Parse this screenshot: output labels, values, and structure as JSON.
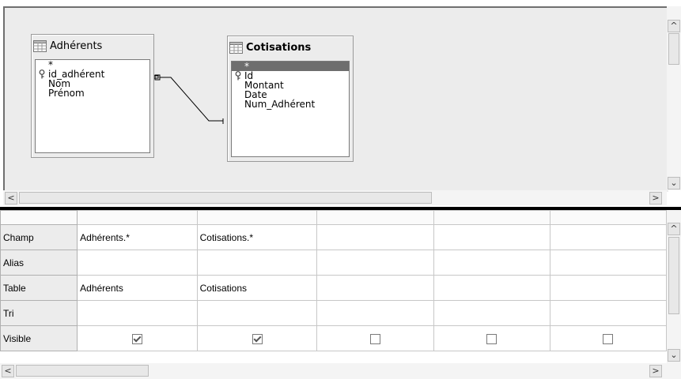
{
  "designer": {
    "tables": [
      {
        "name": "Adhérents",
        "fields": [
          "*",
          "id_adhérent",
          "Nom",
          "Prénom"
        ],
        "key_field_index": 1
      },
      {
        "name": "Cotisations",
        "fields": [
          "*",
          "Id",
          "Montant",
          "Date",
          "Num_Adhérent"
        ],
        "key_field_index": 1,
        "selected_field_index": 0
      }
    ],
    "relation": {
      "from": "Adhérents.id_adhérent",
      "to": "Cotisations.Num_Adhérent"
    }
  },
  "grid": {
    "row_headers": [
      "Champ",
      "Alias",
      "Table",
      "Tri",
      "Visible"
    ],
    "columns": [
      {
        "champ": "Adhérents.*",
        "alias": "",
        "table": "Adhérents",
        "tri": "",
        "visible": true
      },
      {
        "champ": "Cotisations.*",
        "alias": "",
        "table": "Cotisations",
        "tri": "",
        "visible": true
      },
      {
        "champ": "",
        "alias": "",
        "table": "",
        "tri": "",
        "visible": false
      },
      {
        "champ": "",
        "alias": "",
        "table": "",
        "tri": "",
        "visible": false
      },
      {
        "champ": "",
        "alias": "",
        "table": "",
        "tri": "",
        "visible": false
      }
    ]
  },
  "icons": {
    "table": "table-grid-icon",
    "key": "primary-key-icon",
    "arrows": [
      "scroll-left-icon",
      "scroll-right-icon",
      "scroll-up-icon",
      "scroll-down-icon"
    ]
  }
}
